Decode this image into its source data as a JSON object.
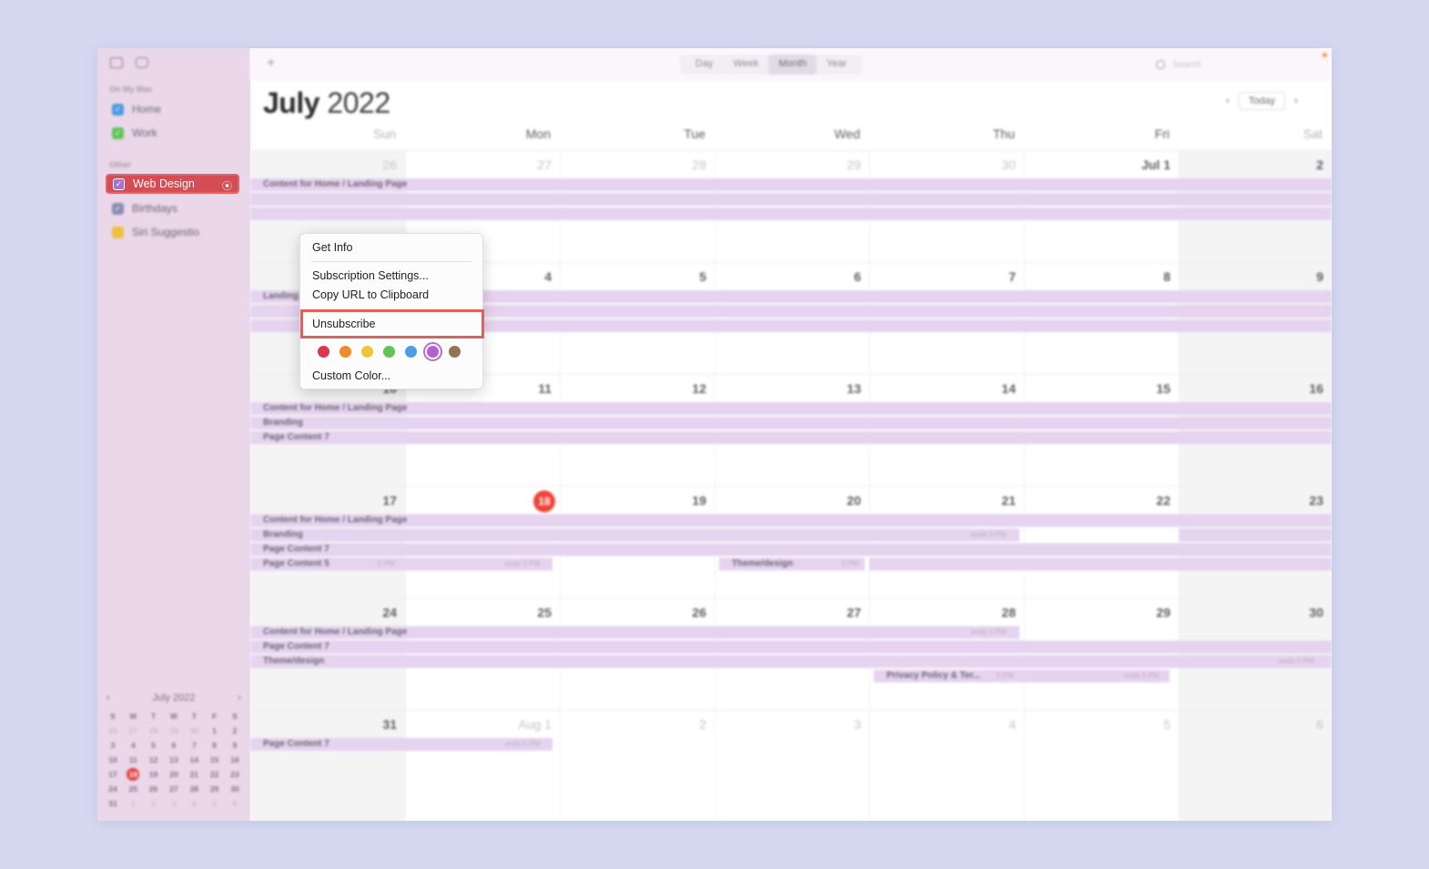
{
  "sidebar": {
    "sections": {
      "on_my_mac": "On My Mac",
      "other": "Other"
    },
    "calendars": [
      {
        "label": "Home",
        "color": "#4a9be0"
      },
      {
        "label": "Work",
        "color": "#5fc45a"
      }
    ],
    "other_calendars": [
      {
        "label": "Web Design",
        "color": "#b06dd0"
      },
      {
        "label": "Birthdays",
        "color": "#8c8cae"
      },
      {
        "label": "Siri Suggestio",
        "color": "#efbf41"
      }
    ],
    "mini_calendar": {
      "title": "July 2022",
      "weekday_initials": [
        "S",
        "M",
        "T",
        "W",
        "T",
        "F",
        "S"
      ],
      "weeks": [
        [
          "26",
          "27",
          "28",
          "29",
          "30",
          "1",
          "2"
        ],
        [
          "3",
          "4",
          "5",
          "6",
          "7",
          "8",
          "9"
        ],
        [
          "10",
          "11",
          "12",
          "13",
          "14",
          "15",
          "16"
        ],
        [
          "17",
          "18",
          "19",
          "20",
          "21",
          "22",
          "23"
        ],
        [
          "24",
          "25",
          "26",
          "27",
          "28",
          "29",
          "30"
        ],
        [
          "31",
          "1",
          "2",
          "3",
          "4",
          "5",
          "6"
        ]
      ]
    }
  },
  "toolbar": {
    "add_label": "+",
    "views": [
      "Day",
      "Week",
      "Month",
      "Year"
    ],
    "active_view": "Month",
    "search_placeholder": "Search"
  },
  "header": {
    "month": "July",
    "year": "2022",
    "today_label": "Today"
  },
  "weekdays": [
    "Sun",
    "Mon",
    "Tue",
    "Wed",
    "Thu",
    "Fri",
    "Sat"
  ],
  "weeks": [
    [
      "26",
      "27",
      "28",
      "29",
      "30",
      "Jul 1",
      "2"
    ],
    [
      "3",
      "4",
      "5",
      "6",
      "7",
      "8",
      "9"
    ],
    [
      "10",
      "11",
      "12",
      "13",
      "14",
      "15",
      "16"
    ],
    [
      "17",
      "18",
      "19",
      "20",
      "21",
      "22",
      "23"
    ],
    [
      "24",
      "25",
      "26",
      "27",
      "28",
      "29",
      "30"
    ],
    [
      "31",
      "Aug 1",
      "2",
      "3",
      "4",
      "5",
      "6"
    ]
  ],
  "today": "18",
  "events": {
    "w0": [
      "Content for Home / Landing Page"
    ],
    "w1": [
      "Landing Page"
    ],
    "w2": [
      "Content for Home / Landing Page",
      "Branding",
      "Page Content 7"
    ],
    "w3": [
      "Content for Home / Landing Page",
      "Branding",
      "Page Content 7",
      "Page Content 5",
      "Theme/design"
    ],
    "w4": [
      "Content for Home / Landing Page",
      "Page Content 7",
      "Theme/design",
      "Privacy Policy & Ter..."
    ],
    "w5": [
      "Page Content 7"
    ],
    "notes": {
      "pm": "5 PM",
      "ends": "ends 5 PM"
    }
  },
  "context_menu": {
    "get_info": "Get Info",
    "subscription_settings": "Subscription Settings...",
    "copy_url": "Copy URL to Clipboard",
    "unsubscribe": "Unsubscribe",
    "custom_color": "Custom Color...",
    "colors": [
      "#e0344e",
      "#ef8a2d",
      "#f1c33b",
      "#62c553",
      "#4c9ce8",
      "#b15fd1",
      "#937456"
    ],
    "selected_color": "#b15fd1"
  }
}
